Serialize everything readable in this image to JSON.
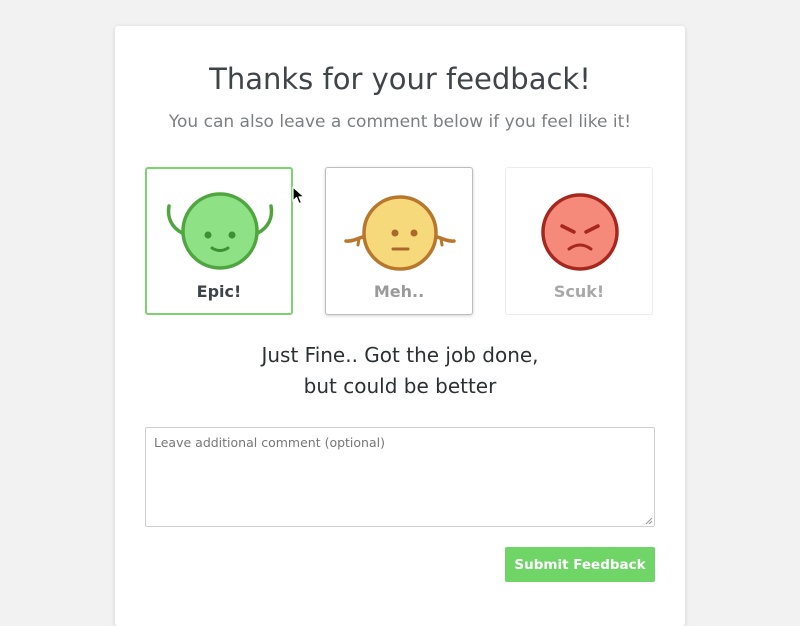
{
  "header": {
    "title": "Thanks for your feedback!",
    "subtitle": "You can also leave a comment below if you feel like it!"
  },
  "options": [
    {
      "label": "Epic!",
      "icon": "happy-face-icon",
      "state": "selected",
      "color": "#84e07a"
    },
    {
      "label": "Meh..",
      "icon": "neutral-face-icon",
      "state": "hover",
      "color": "#f5d878"
    },
    {
      "label": "Scuk!",
      "icon": "angry-face-icon",
      "state": "default",
      "color": "#f5897a"
    }
  ],
  "message": {
    "line1": "Just Fine.. Got the job done,",
    "line2": "but could be better"
  },
  "comment": {
    "value": "",
    "placeholder": "Leave additional comment (optional)"
  },
  "submit": {
    "label": "Submit Feedback",
    "color": "#6fd567"
  },
  "colors": {
    "accent": "#6fd567",
    "selected_border": "#7cd36f"
  }
}
